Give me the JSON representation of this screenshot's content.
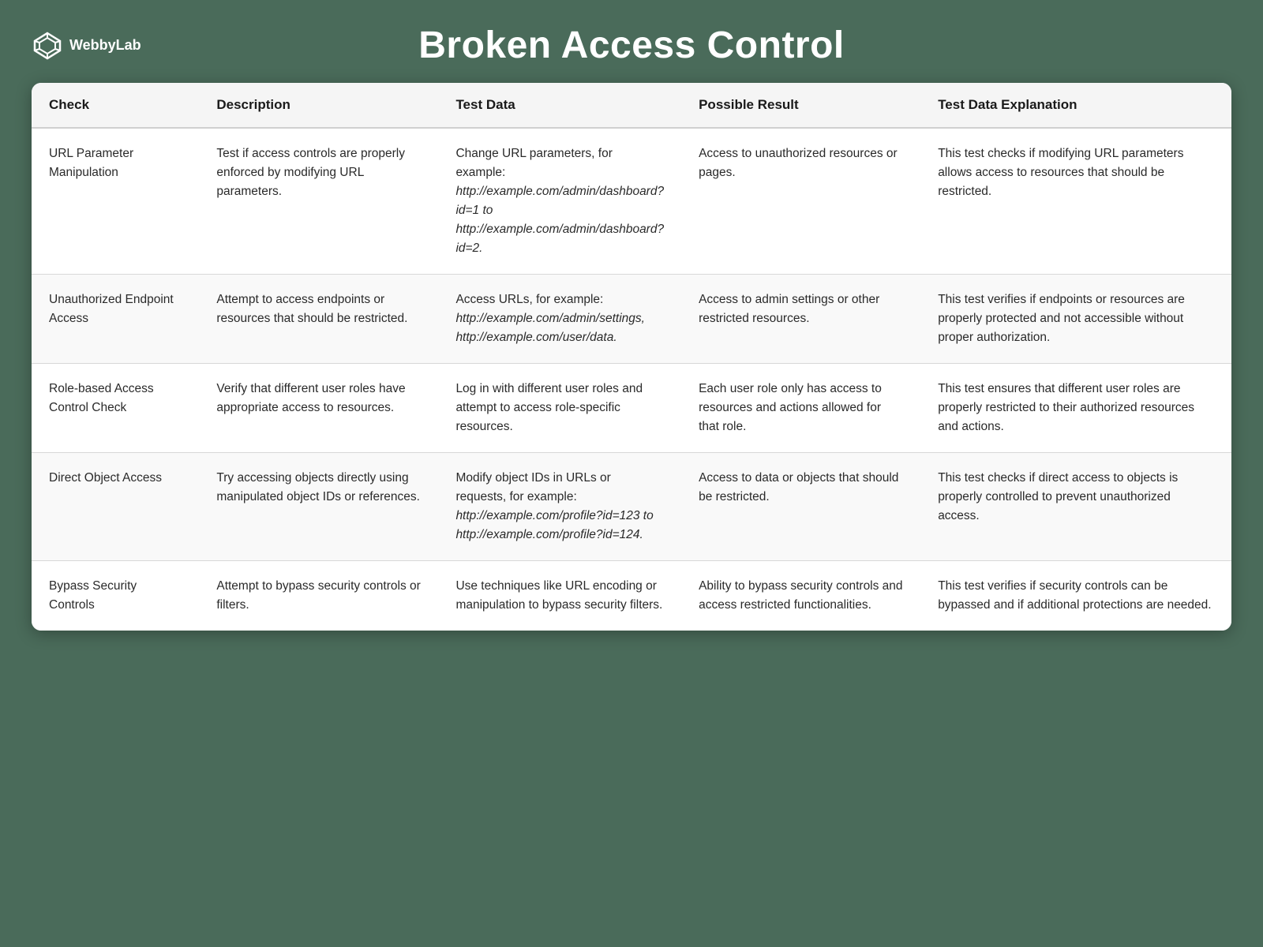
{
  "header": {
    "logo_text": "WebbyLab",
    "page_title": "Broken Access Control"
  },
  "table": {
    "columns": [
      {
        "id": "check",
        "label": "Check"
      },
      {
        "id": "description",
        "label": "Description"
      },
      {
        "id": "testdata",
        "label": "Test Data"
      },
      {
        "id": "result",
        "label": "Possible Result"
      },
      {
        "id": "explanation",
        "label": "Test Data Explanation"
      }
    ],
    "rows": [
      {
        "check": "URL Parameter Manipulation",
        "description": "Test if access controls are properly enforced by modifying URL parameters.",
        "testdata_plain": "Change URL parameters, for example: ",
        "testdata_italic": "http://example.com/admin/dashboard?id=1 to http://example.com/admin/dashboard?id=2.",
        "result": "Access to unauthorized resources or pages.",
        "explanation": "This test checks if modifying URL parameters allows access to resources that should be restricted."
      },
      {
        "check": "Unauthorized Endpoint Access",
        "description": "Attempt to access endpoints or resources that should be restricted.",
        "testdata_plain": "Access URLs, for example: ",
        "testdata_italic": "http://example.com/admin/settings, http://example.com/user/data.",
        "result": "Access to admin settings or other restricted resources.",
        "explanation": "This test verifies if endpoints or resources are properly protected and not accessible without proper authorization."
      },
      {
        "check": "Role-based Access Control Check",
        "description": "Verify that different user roles have appropriate access to resources.",
        "testdata_plain": "Log in with different user roles and attempt to access role-specific resources.",
        "testdata_italic": "",
        "result": "Each user role only has access to resources and actions allowed for that role.",
        "explanation": "This test ensures that different user roles are properly restricted to their authorized resources and actions."
      },
      {
        "check": "Direct Object Access",
        "description": "Try accessing objects directly using manipulated object IDs or references.",
        "testdata_plain": "Modify object IDs in URLs or requests, for example: ",
        "testdata_italic": "http://example.com/profile?id=123 to http://example.com/profile?id=124.",
        "result": "Access to data or objects that should be restricted.",
        "explanation": "This test checks if direct access to objects is properly controlled to prevent unauthorized access."
      },
      {
        "check": "Bypass Security Controls",
        "description": "Attempt to bypass security controls or filters.",
        "testdata_plain": "Use techniques like URL encoding or manipulation to bypass security filters.",
        "testdata_italic": "",
        "result": "Ability to bypass security controls and access restricted functionalities.",
        "explanation": "This test verifies if security controls can be bypassed and if additional protections are needed."
      }
    ]
  }
}
